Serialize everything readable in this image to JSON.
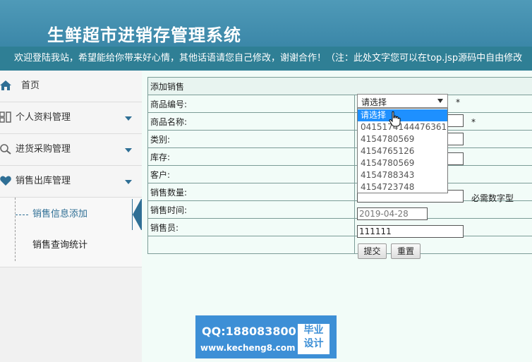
{
  "header": {
    "title": "生鲜超市进销存管理系统",
    "marquee": "欢迎登陆我站，希望能给你带来好心情，其他话语请您自己修改，谢谢合作！（注：此处文字您可以在top.jsp源码中自由修改"
  },
  "sidebar": {
    "items": [
      {
        "label": "首页",
        "icon": "home-icon"
      },
      {
        "label": "个人资料管理",
        "icon": "grid-icon"
      },
      {
        "label": "进货采购管理",
        "icon": "search-icon"
      },
      {
        "label": "销售出库管理",
        "icon": "heart-icon"
      }
    ],
    "submenu": [
      {
        "label": "销售信息添加",
        "active": true
      },
      {
        "label": "销售查询统计",
        "active": false
      }
    ]
  },
  "form": {
    "caption": "添加销售",
    "labels": {
      "code": "商品编号:",
      "name": "商品名称:",
      "category": "类别:",
      "stock": "库存:",
      "customer": "客户:",
      "quantity": "销售数量:",
      "time": "销售时间:",
      "seller": "销售员:"
    },
    "required_mark": "*",
    "quantity_hint": "必需数字型",
    "values": {
      "time": "2019-04-28",
      "seller": "111111"
    },
    "select": {
      "selected": "请选择",
      "options": [
        "请选择",
        "0415174144476361",
        "4154780569",
        "4154765126",
        "4154780569",
        "4154788343",
        "4154723748"
      ]
    },
    "buttons": {
      "submit": "提交",
      "reset": "重置"
    }
  },
  "watermark": {
    "qq": "QQ:188083800",
    "url": "www.kecheng8.com",
    "box_line1": "毕业",
    "box_line2": "设计"
  },
  "colors": {
    "header": "#3b87a8",
    "marquee_bg": "#2f7f95",
    "accent": "#2f6f95",
    "selected_option": "#1e90ff"
  }
}
